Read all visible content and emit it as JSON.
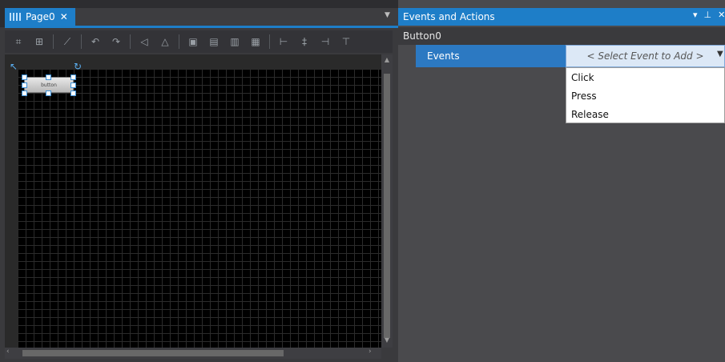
{
  "document": {
    "tab_label": "Page0",
    "canvas_button_text": "button"
  },
  "panel": {
    "title": "Events and Actions",
    "object_name": "Button0",
    "events_label": "Events",
    "select_placeholder": "< Select Event to Add >",
    "options": [
      "Click",
      "Press",
      "Release"
    ]
  },
  "icons": {
    "tab_icon": "page-grid-icon",
    "toolbar": [
      "resize-icon",
      "resize-alt-icon",
      "skew-icon",
      "rotate-left-icon",
      "rotate-right-icon",
      "flip-horizontal-icon",
      "flip-vertical-icon",
      "bring-front-icon",
      "send-back-icon",
      "bring-forward-icon",
      "send-backward-icon",
      "align-left-icon",
      "align-center-icon",
      "align-right-icon",
      "align-top-icon"
    ]
  },
  "colors": {
    "accent": "#1e7ec8",
    "canvas": "#000000"
  }
}
